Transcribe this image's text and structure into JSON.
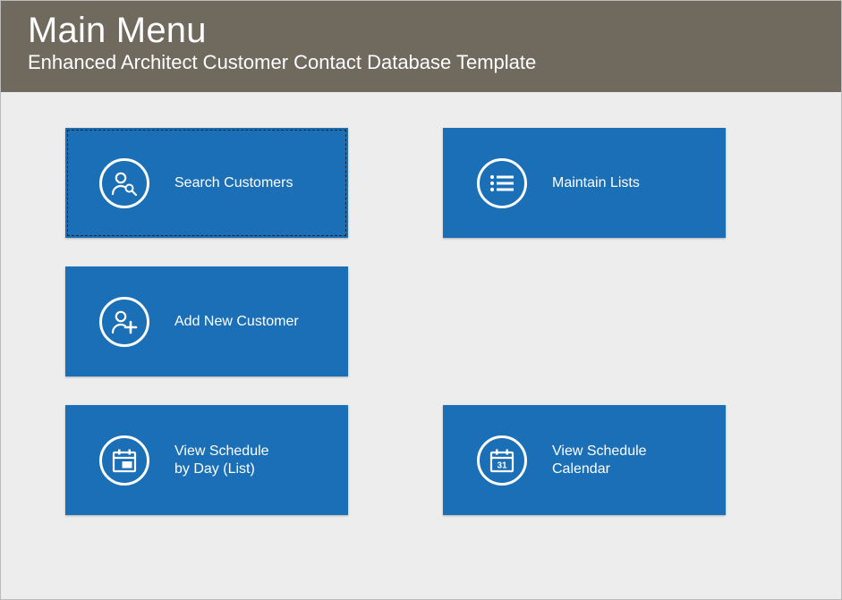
{
  "header": {
    "title": "Main Menu",
    "subtitle": "Enhanced Architect Customer Contact Database Template"
  },
  "menu": {
    "search_customers": "Search Customers",
    "add_new_customer": "Add New Customer",
    "view_schedule_list": "View Schedule\nby Day (List)",
    "maintain_lists": "Maintain Lists",
    "view_schedule_calendar": "View Schedule\nCalendar"
  },
  "colors": {
    "header_bg": "#6f695e",
    "card_bg": "#1a6fb6",
    "page_bg": "#ededed"
  }
}
